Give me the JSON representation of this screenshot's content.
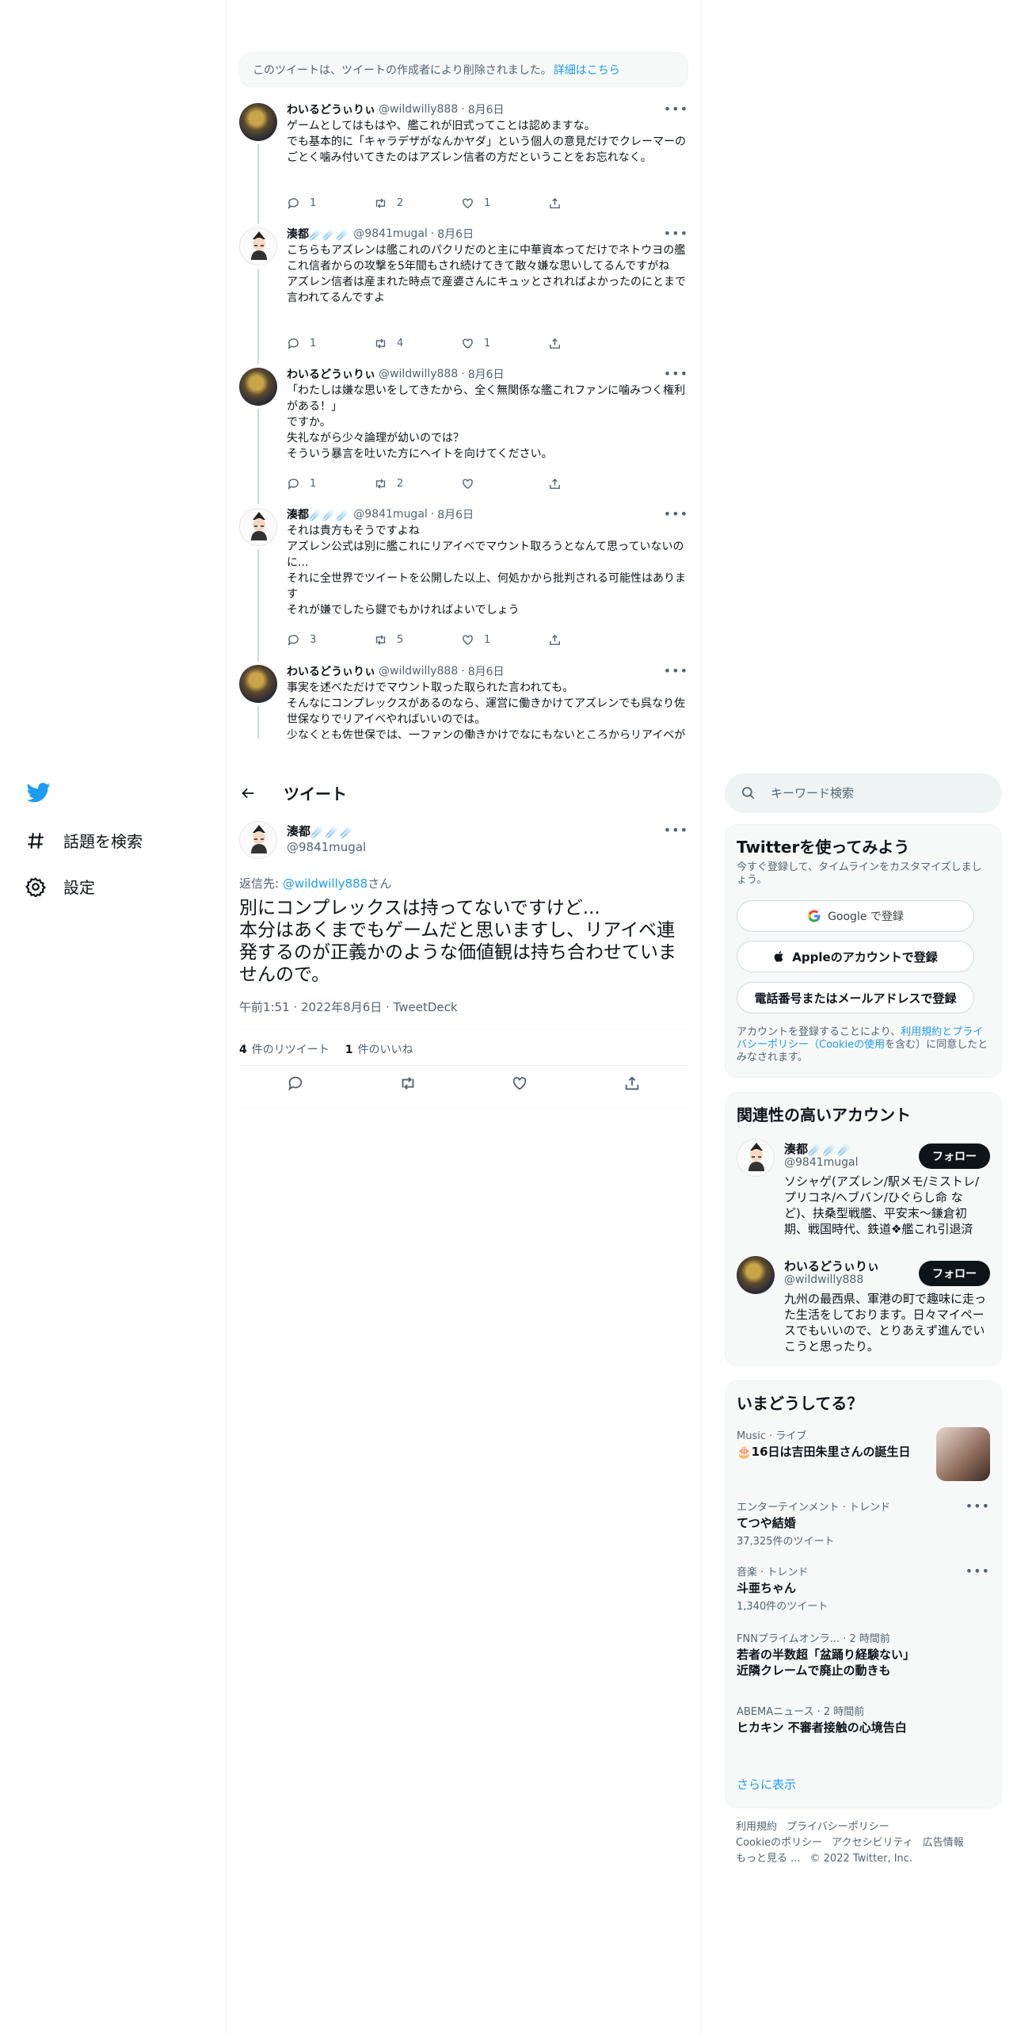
{
  "nav": {
    "explore_label": "話題を検索",
    "settings_label": "設定"
  },
  "deleted_notice": {
    "text": "このツイートは、ツイートの作成者により削除されました。",
    "link": "詳細はこちら"
  },
  "thread": [
    {
      "name": "わいるどうぃりぃ",
      "handle": "@wildwilly888",
      "date": "8月6日",
      "text": "ゲームとしてはもはや、艦これが旧式ってことは認めますな。\nでも基本的に「キャラデザがなんかヤダ」という個人の意見だけでクレーマーのごとく噛み付いてきたのはアズレン信者の方だということをお忘れなく。",
      "replies": "1",
      "retweets": "2",
      "likes": "1"
    },
    {
      "name": "湊都☄️☄️☄️",
      "handle": "@9841mugal",
      "date": "8月6日",
      "text": "こちらもアズレンは艦これのパクリだのと主に中華資本ってだけでネトウヨの艦これ信者からの攻撃を5年間もされ続けてきて散々嫌な思いしてるんですがね\nアズレン信者は産まれた時点で産婆さんにキュッとされればよかったのにとまで言われてるんですよ",
      "replies": "1",
      "retweets": "4",
      "likes": "1"
    },
    {
      "name": "わいるどうぃりぃ",
      "handle": "@wildwilly888",
      "date": "8月6日",
      "text": "「わたしは嫌な思いをしてきたから、全く無関係な艦これファンに噛みつく権利がある！」\nですか。\n失礼ながら少々論理が幼いのでは？\nそういう暴言を吐いた方にヘイトを向けてください。",
      "replies": "1",
      "retweets": "2",
      "likes": ""
    },
    {
      "name": "湊都☄️☄️☄️",
      "handle": "@9841mugal",
      "date": "8月6日",
      "text": "それは貴方もそうですよね\nアズレン公式は別に艦これにリアイベでマウント取ろうとなんて思っていないのに...\nそれに全世界でツイートを公開した以上、何処かから批判される可能性はあります\nそれが嫌でしたら鍵でもかければよいでしょう",
      "replies": "3",
      "retweets": "5",
      "likes": "1"
    },
    {
      "name": "わいるどうぃりぃ",
      "handle": "@wildwilly888",
      "date": "8月6日",
      "text": "事実を述べただけでマウント取った取られた言われても。\nそんなにコンプレックスがあるのなら、運営に働きかけてアズレンでも呉なり佐世保なりでリアイベやればいいのでは。\n少なくとも佐世保では、一ファンの働きかけでなにもないところからリアイベが実現しましたよ。\nアズレンだってやれますって。",
      "replies": "",
      "retweets": "",
      "likes": ""
    }
  ],
  "header": {
    "title": "ツイート"
  },
  "focus": {
    "name": "湊都☄️☄️☄️",
    "handle": "@9841mugal",
    "reply_prefix": "返信先: ",
    "reply_to": "@wildwilly888",
    "reply_suffix": "さん",
    "text": "別にコンプレックスは持ってないですけど...\n本分はあくまでもゲームだと思いますし、リアイベ連発するのが正義かのような価値観は持ち合わせていませんので。",
    "meta": "午前1:51 · 2022年8月6日 · TweetDeck",
    "retweet_count": "4",
    "retweet_label": "件のリツイート",
    "like_count": "1",
    "like_label": "件のいいね"
  },
  "search": {
    "placeholder": "キーワード検索"
  },
  "signup": {
    "title": "Twitterを使ってみよう",
    "subtitle": "今すぐ登録して、タイムラインをカスタマイズしましょう。",
    "google_label": "Google で登録",
    "apple_label": "Appleのアカウントで登録",
    "phone_label": "電話番号またはメールアドレスで登録",
    "terms_prefix": "アカウントを登録することにより、",
    "terms_link": "利用規約とプライバシーポリシー（Cookieの使用",
    "terms_suffix": "を含む）に同意したとみなされます。"
  },
  "related": {
    "title": "関連性の高いアカウント",
    "follow_label": "フォロー",
    "accounts": [
      {
        "name": "湊都☄️☄️☄️",
        "handle": "@9841mugal",
        "bio": "ソシャゲ(アズレン/駅メモ/ミストレ/プリコネ/ヘブバン/ひぐらし命 など)、扶桑型戦艦、平安末～鎌倉初期、戦国時代、鉄道❖艦これ引退済"
      },
      {
        "name": "わいるどうぃりぃ",
        "handle": "@wildwilly888",
        "bio": "九州の最西県、軍港の町で趣味に走った生活をしております。日々マイペースでもいいので、とりあえず進んでいこうと思ったり。"
      }
    ]
  },
  "trends": {
    "title": "いまどうしてる？",
    "items": [
      {
        "category": "Music · ライブ",
        "title": "🎂16日は吉田朱里さんの誕生日",
        "count": ""
      },
      {
        "category": "エンターテインメント · トレンド",
        "title": "てつや結婚",
        "count": "37,325件のツイート"
      },
      {
        "category": "音楽 · トレンド",
        "title": "斗亜ちゃん",
        "count": "1,340件のツイート"
      },
      {
        "category": "FNNプライムオンラ... · 2 時間前",
        "title": "若者の半数超「盆踊り経験ない」\n近隣クレームで廃止の動きも",
        "count": ""
      },
      {
        "category": "ABEMAニュース · 2 時間前",
        "title": "ヒカキン 不審者接触の心境告白",
        "count": ""
      }
    ],
    "show_more": "さらに表示"
  },
  "footer": {
    "links": [
      "利用規約",
      "プライバシーポリシー",
      "Cookieのポリシー",
      "アクセシビリティ",
      "広告情報",
      "もっと見る ..."
    ],
    "copyright": "© 2022 Twitter, Inc."
  },
  "colors": {
    "accent": "#1d9bf0",
    "text": "#0f1419",
    "muted": "#536471",
    "border": "#eff3f4"
  }
}
